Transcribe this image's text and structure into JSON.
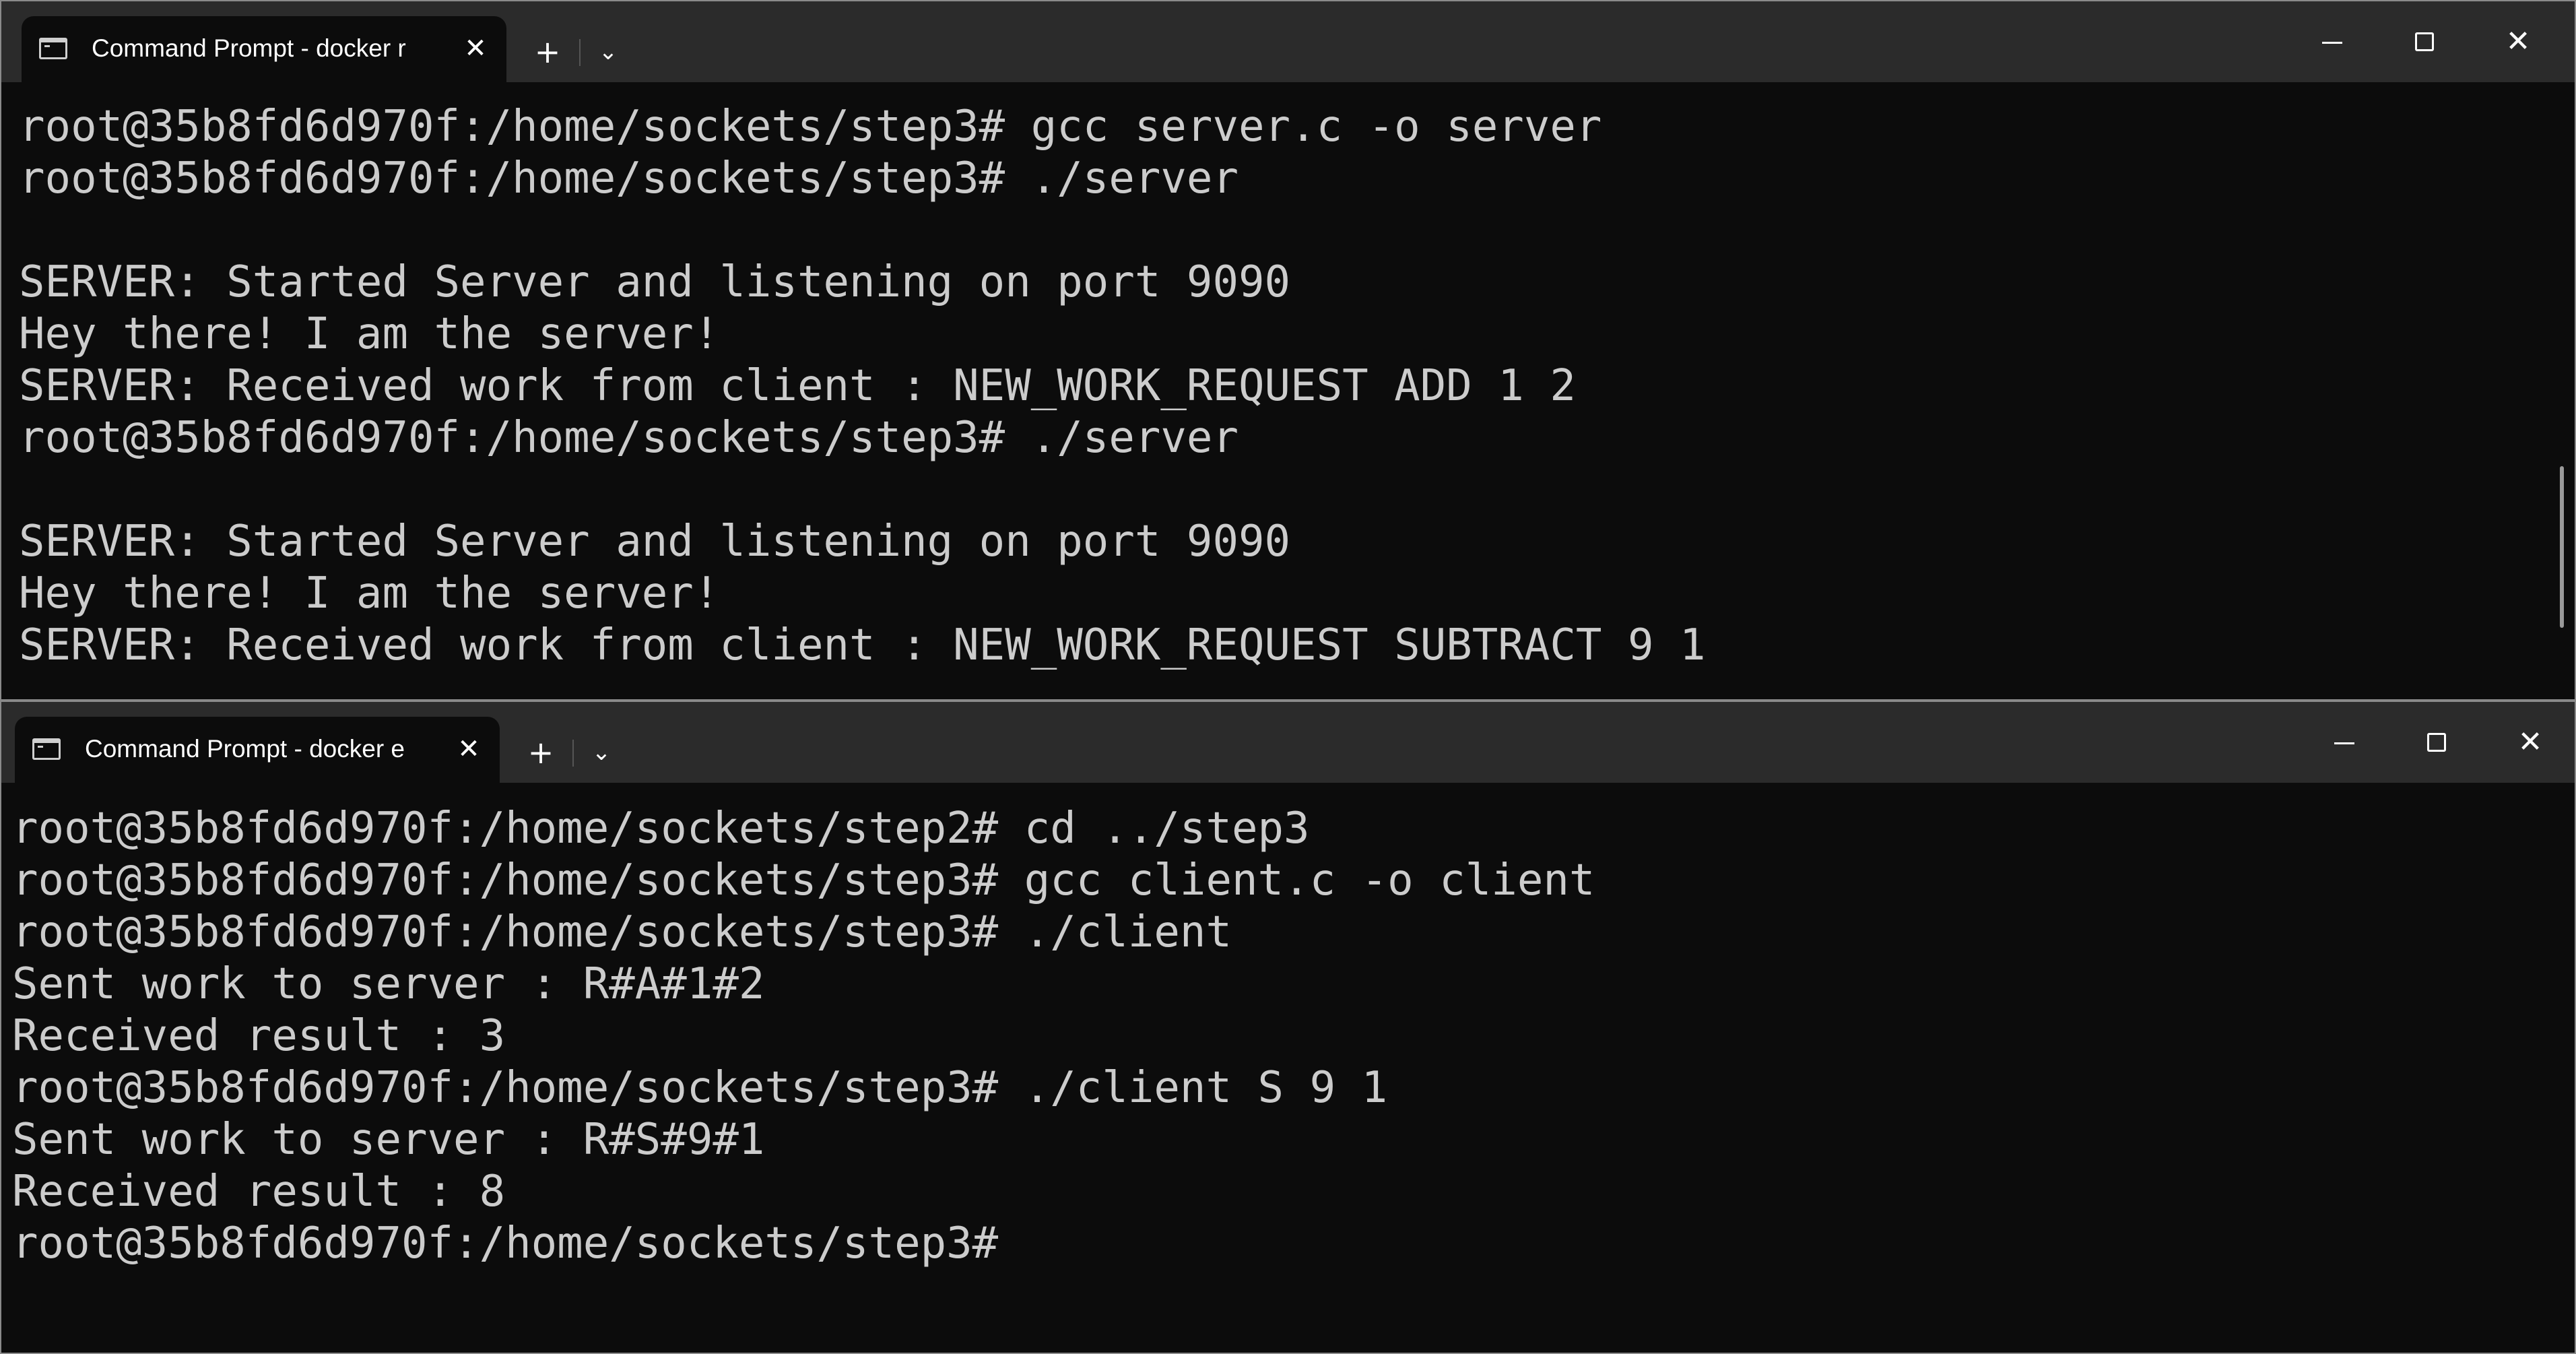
{
  "server_window": {
    "tab_title": "Command Prompt - docker r",
    "tab_close": "✕",
    "new_tab": "+",
    "dropdown": "⌄",
    "close": "✕",
    "lines": [
      "root@35b8fd6d970f:/home/sockets/step3# gcc server.c -o server",
      "root@35b8fd6d970f:/home/sockets/step3# ./server",
      "",
      "SERVER: Started Server and listening on port 9090",
      "Hey there! I am the server!",
      "SERVER: Received work from client : NEW_WORK_REQUEST ADD 1 2",
      "root@35b8fd6d970f:/home/sockets/step3# ./server",
      "",
      "SERVER: Started Server and listening on port 9090",
      "Hey there! I am the server!",
      "SERVER: Received work from client : NEW_WORK_REQUEST SUBTRACT 9 1"
    ]
  },
  "client_window": {
    "tab_title": "Command Prompt - docker e",
    "tab_close": "✕",
    "new_tab": "+",
    "dropdown": "⌄",
    "close": "✕",
    "lines": [
      "root@35b8fd6d970f:/home/sockets/step2# cd ../step3",
      "root@35b8fd6d970f:/home/sockets/step3# gcc client.c -o client",
      "root@35b8fd6d970f:/home/sockets/step3# ./client",
      "Sent work to server : R#A#1#2",
      "Received result : 3",
      "root@35b8fd6d970f:/home/sockets/step3# ./client S 9 1",
      "Sent work to server : R#S#9#1",
      "Received result : 8",
      "root@35b8fd6d970f:/home/sockets/step3#"
    ]
  },
  "colors": {
    "terminal_bg": "#0c0c0c",
    "titlebar_bg": "#2b2b2b",
    "terminal_text": "#cccccc"
  }
}
